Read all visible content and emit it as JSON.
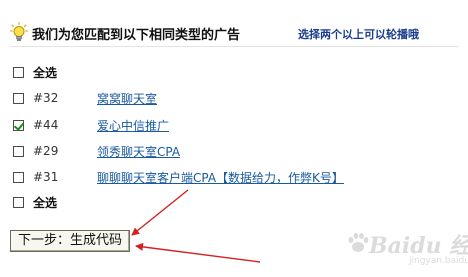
{
  "header": {
    "title": "我们为您匹配到以下相同类型的广告",
    "hint": "选择两个以上可以轮播哦"
  },
  "select_all_label": "全选",
  "ads": [
    {
      "id": "#32",
      "name": "窝窝聊天室",
      "checked": false
    },
    {
      "id": "#44",
      "name": "爱心中信推广",
      "checked": true
    },
    {
      "id": "#29",
      "name": "领秀聊天室CPA",
      "checked": false
    },
    {
      "id": "#31",
      "name": "聊聊聊天室客户端CPA【数据给力，作弊K号】",
      "checked": false
    }
  ],
  "next_button": {
    "label": "下一步：生成代码"
  },
  "watermark": {
    "brand": "Baidu 经验",
    "sub": "jingyan.baidu.com"
  },
  "colors": {
    "link": "#1a5aa0",
    "hint": "#1a3c8f",
    "annotation_arrow": "#d42020",
    "check": "#1c8a1c"
  }
}
